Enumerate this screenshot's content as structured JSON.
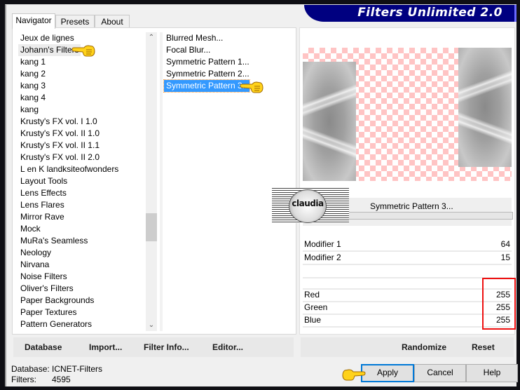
{
  "window": {
    "title": "Filters Unlimited 2.0"
  },
  "tabs": [
    {
      "label": "Navigator",
      "active": true
    },
    {
      "label": "Presets",
      "active": false
    },
    {
      "label": "About",
      "active": false
    }
  ],
  "categories": {
    "selected": "Johann's Filters",
    "items": [
      "Jeux de lignes",
      "Johann's Filters",
      "kang 1",
      "kang 2",
      "kang 3",
      "kang 4",
      "kang",
      "Krusty's FX vol. I 1.0",
      "Krusty's FX vol. II 1.0",
      "Krusty's FX vol. II 1.1",
      "Krusty's FX vol. II 2.0",
      "L en K landksiteofwonders",
      "Layout Tools",
      "Lens Effects",
      "Lens Flares",
      "Mirror Rave",
      "Mock",
      "MuRa's Seamless",
      "Neology",
      "Nirvana",
      "Noise Filters",
      "Oliver's Filters",
      "Paper Backgrounds",
      "Paper Textures",
      "Pattern Generators"
    ]
  },
  "filters": {
    "selected": "Symmetric Pattern 3...",
    "items": [
      "Blurred Mesh...",
      "Focal Blur...",
      "Symmetric Pattern 1...",
      "Symmetric Pattern 2...",
      "Symmetric Pattern 3..."
    ]
  },
  "left_buttons": {
    "database": "Database",
    "import": "Import...",
    "filter_info": "Filter Info...",
    "editor": "Editor..."
  },
  "preview": {
    "filter_name": "Symmetric Pattern 3...",
    "watermark": "claudia"
  },
  "params": [
    {
      "label": "Modifier 1",
      "value": "64"
    },
    {
      "label": "Modifier 2",
      "value": "15"
    }
  ],
  "color_params": [
    {
      "label": "Red",
      "value": "255"
    },
    {
      "label": "Green",
      "value": "255"
    },
    {
      "label": "Blue",
      "value": "255"
    }
  ],
  "right_buttons": {
    "randomize": "Randomize",
    "reset": "Reset"
  },
  "status": {
    "database_label": "Database:",
    "database_value": "ICNET-Filters",
    "filters_label": "Filters:",
    "filters_value": "4595"
  },
  "dialog_buttons": {
    "apply": "Apply",
    "cancel": "Cancel",
    "help": "Help"
  },
  "colors": {
    "banner": "#000080",
    "selection": "#3399ff",
    "highlight": "#ee1111",
    "checker": "#ffc4c4"
  }
}
